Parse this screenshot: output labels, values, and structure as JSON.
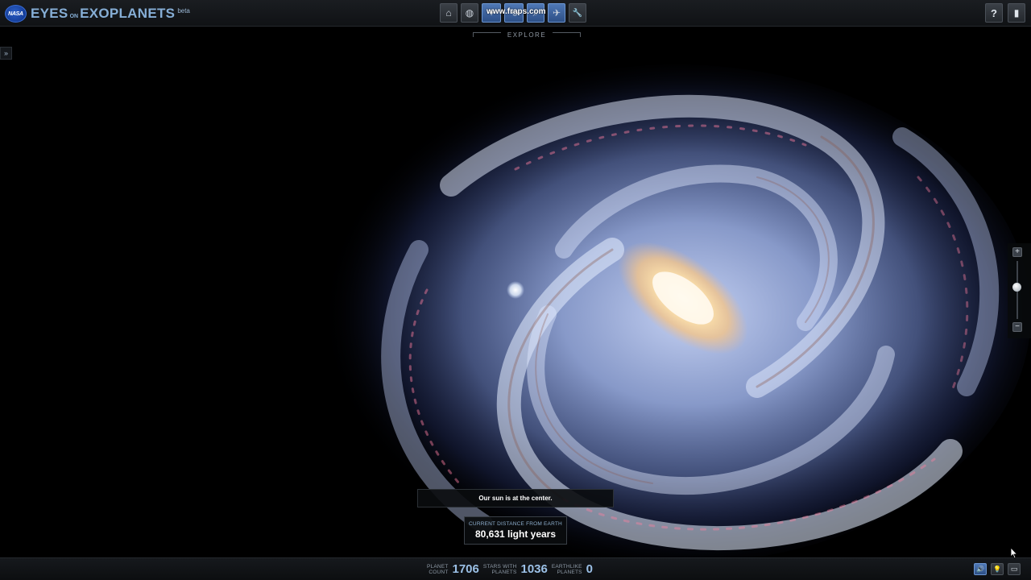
{
  "app": {
    "logo_text": "NASA",
    "title_part1": "EYES",
    "title_part2": "ON",
    "title_part3": "EXOPLANETS",
    "beta_label": "beta"
  },
  "toolbar": {
    "buttons": [
      {
        "icon": "home-icon",
        "glyph": "⌂"
      },
      {
        "icon": "globe-icon",
        "glyph": "◍"
      },
      {
        "icon": "star-map-icon",
        "glyph": "✦"
      },
      {
        "icon": "orbit-icon",
        "glyph": "⟲"
      },
      {
        "icon": "search-icon",
        "glyph": "⌕"
      },
      {
        "icon": "fly-icon",
        "glyph": "✈"
      },
      {
        "icon": "wrench-icon",
        "glyph": "🔧"
      }
    ],
    "watermark": "www.fraps.com",
    "mode_label": "EXPLORE"
  },
  "header_right": {
    "help_glyph": "?",
    "fullscreen_glyph": "▮"
  },
  "side_toggle_glyph": "»",
  "zoom": {
    "plus": "+",
    "minus": "−",
    "level": 0.45
  },
  "caption": "Our sun is at the center.",
  "distance": {
    "label": "CURRENT DISTANCE FROM EARTH",
    "value": "80,631 light years"
  },
  "stats": [
    {
      "label_line1": "PLANET",
      "label_line2": "COUNT",
      "value": "1706"
    },
    {
      "label_line1": "STARS WITH",
      "label_line2": "PLANETS",
      "value": "1036"
    },
    {
      "label_line1": "EARTHLIKE",
      "label_line2": "PLANETS",
      "value": "0"
    }
  ],
  "bottom_buttons": [
    {
      "icon": "sound-icon",
      "glyph": "🔊"
    },
    {
      "icon": "lightbulb-icon",
      "glyph": "💡"
    },
    {
      "icon": "screen-icon",
      "glyph": "▭"
    }
  ],
  "colors": {
    "accent": "#86aed6",
    "active_button": "#3d64a0",
    "stat_value": "#9bc0e6"
  }
}
